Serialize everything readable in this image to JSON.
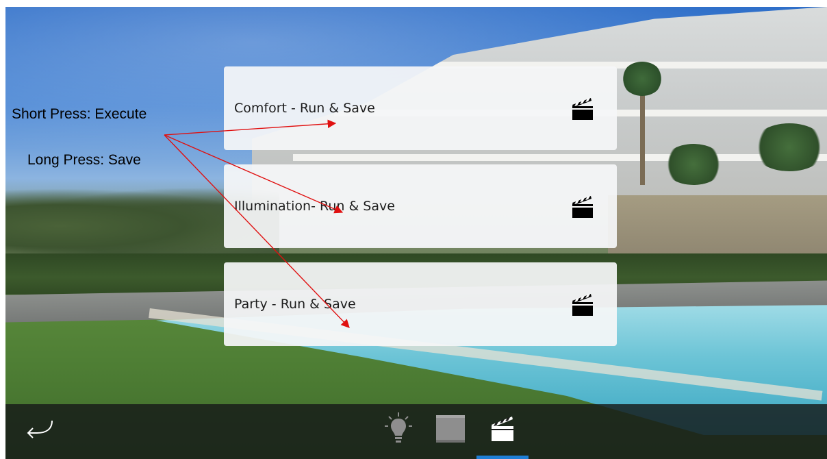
{
  "annotations": {
    "short_press": "Short Press: Execute",
    "long_press": "Long Press: Save",
    "arrow_color": "#e01010"
  },
  "scenes": [
    {
      "label": "Comfort - Run & Save",
      "icon": "clapperboard-icon"
    },
    {
      "label": "Illumination- Run & Save",
      "icon": "clapperboard-icon"
    },
    {
      "label": "Party - Run & Save",
      "icon": "clapperboard-icon"
    }
  ],
  "bottom_bar": {
    "back_icon": "back-arrow-icon",
    "tabs": [
      {
        "icon": "lightbulb-icon",
        "active": false
      },
      {
        "icon": "shutter-icon",
        "active": false
      },
      {
        "icon": "clapperboard-icon",
        "active": true
      }
    ],
    "active_color": "#1f7ed6"
  }
}
